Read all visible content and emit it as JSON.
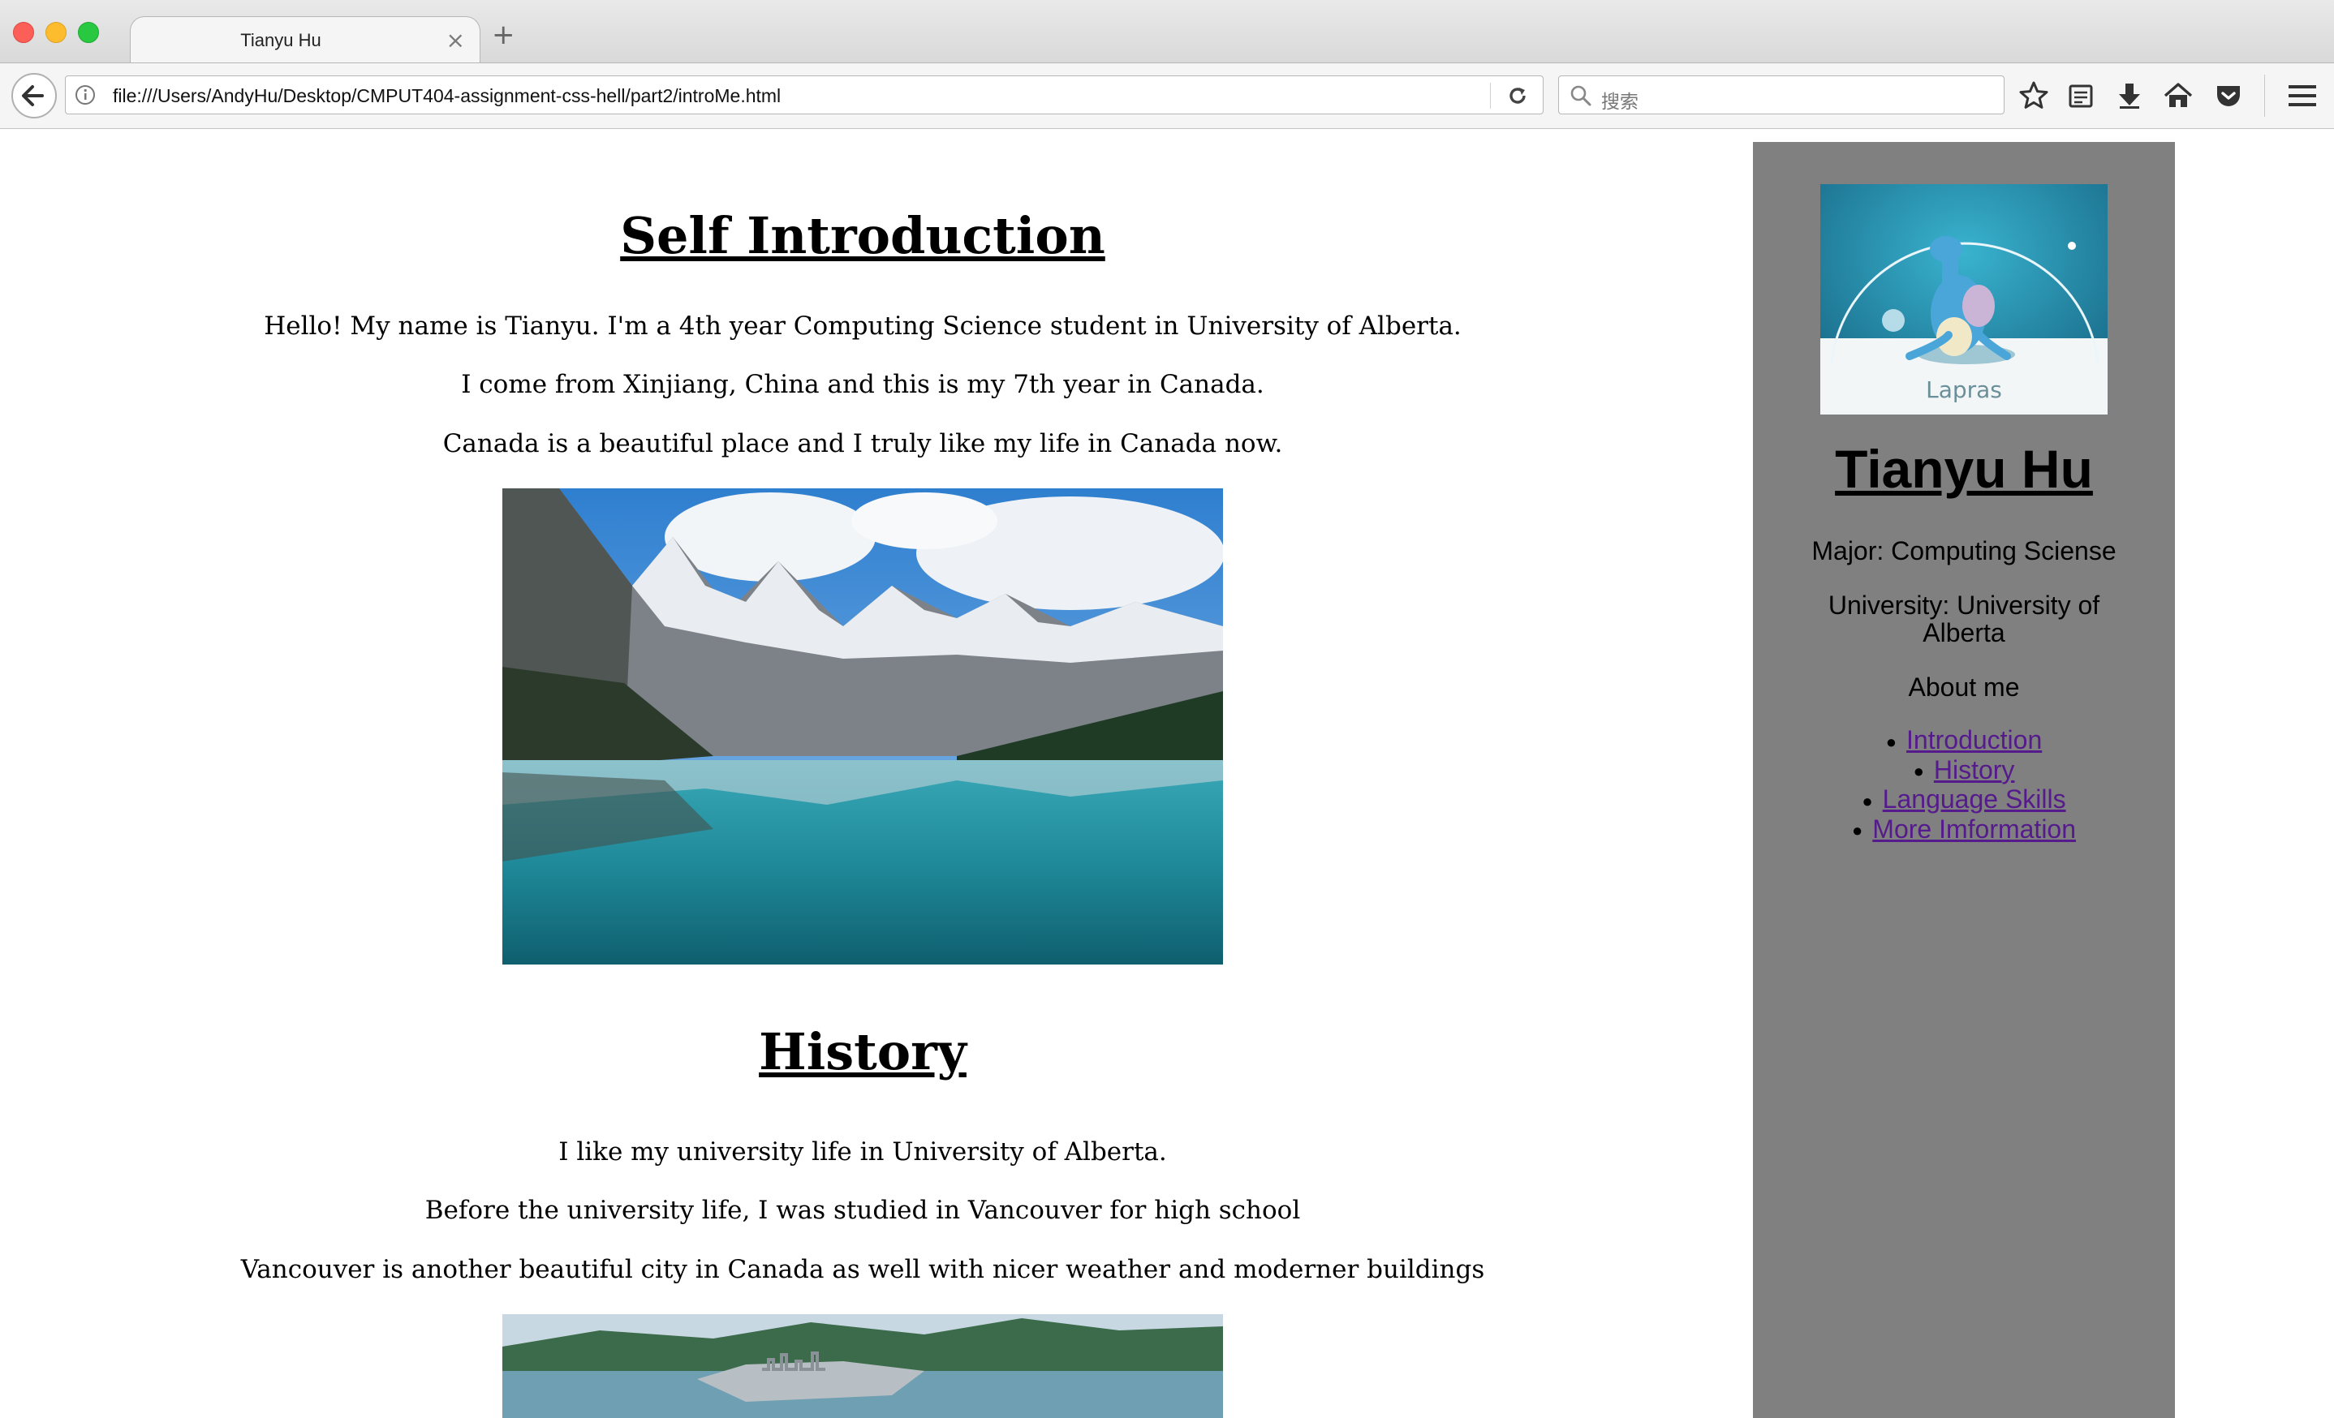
{
  "browser": {
    "tab_title": "Tianyu Hu",
    "tab_close_glyph": "×",
    "new_tab_glyph": "+",
    "url": "file:///Users/AndyHu/Desktop/CMPUT404-assignment-css-hell/part2/introMe.html",
    "search_placeholder": "搜索",
    "icons": [
      "back-arrow-icon",
      "info-icon",
      "reload-icon",
      "search-icon",
      "bookmark-star-icon",
      "reading-list-icon",
      "download-icon",
      "home-icon",
      "pocket-icon",
      "menu-icon"
    ]
  },
  "main": {
    "intro": {
      "heading": "Self Introduction",
      "paragraphs": [
        "Hello! My name is Tianyu. I'm a 4th year Computing Science student in University of Alberta.",
        "I come from Xinjiang, China and this is my 7th year in Canada.",
        "Canada is a beautiful place and I truly like my life in Canada now."
      ],
      "image": "mountain-lake-photo"
    },
    "history": {
      "heading": "History",
      "paragraphs": [
        "I like my university life in University of Alberta.",
        "Before the university life, I was studied in Vancouver for high school",
        "Vancouver is another beautiful city in Canada as well with nicer weather and moderner buildings"
      ],
      "image": "vancouver-city-photo"
    }
  },
  "sidebar": {
    "avatar_caption": "Lapras",
    "name": "Tianyu Hu",
    "major": "Major: Computing Sciense",
    "university": "University: University of Alberta",
    "about": "About me",
    "links": [
      "Introduction",
      "History",
      "Language Skills",
      "More Imformation"
    ]
  },
  "colors": {
    "sidebar_bg": "#808080",
    "visited_link": "#551a8b",
    "chrome_bg": "#f5f5f5"
  }
}
